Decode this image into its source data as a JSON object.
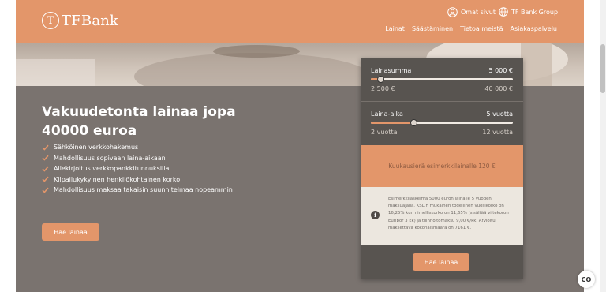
{
  "header": {
    "logo_mark": "T",
    "logo_text": "TFBank",
    "util_links": [
      {
        "label": "Omat sivut",
        "icon": "user-icon"
      },
      {
        "label": "TF Bank Group",
        "icon": "globe-icon"
      }
    ],
    "nav": [
      "Lainat",
      "Säästäminen",
      "Tietoa meistä",
      "Asiakaspalvelu"
    ]
  },
  "hero": {
    "headline": "Vakuudetonta lainaa jopa 40000 euroa",
    "features": [
      "Sähköinen verkkohakemus",
      "Mahdollisuus sopivaan laina-aikaan",
      "Allekirjoitus verkkopankkitunnuksilla",
      "Kilpailukykyinen henkilökohtainen korko",
      "Mahdollisuus maksaa takaisin suunnitelmaa nopeammin"
    ],
    "cta": "Hae lainaa"
  },
  "calculator": {
    "amount": {
      "label": "Lainasumma",
      "value": "5 000 €",
      "min": "2 500 €",
      "max": "40 000 €",
      "level": 0.07
    },
    "term": {
      "label": "Laina-aika",
      "value": "5 vuotta",
      "min": "2 vuotta",
      "max": "12 vuotta",
      "level": 0.3
    },
    "monthly": "Kuukausierä esimerkkilainalle 120 €",
    "info_icon": "info-icon",
    "info_text": "Esimerkkilaskelma 5000 euron lainalle 5 vuoden maksuajalla. KSL:n mukainen todellinen vuosikorko on 16,25% kun nimelliskorko on 11,65% (sisältää viitekoron Euribor 3 kk) ja tilinhoitomaksu 9,00 €/kk. Arvioitu maksettava kokonaismäärä on 7161 €.",
    "cta": "Hae lainaa"
  },
  "cookie_badge": "CO",
  "colors": {
    "accent": "#e3966a",
    "panel": "#585450",
    "page_bg": "#7a736f"
  }
}
